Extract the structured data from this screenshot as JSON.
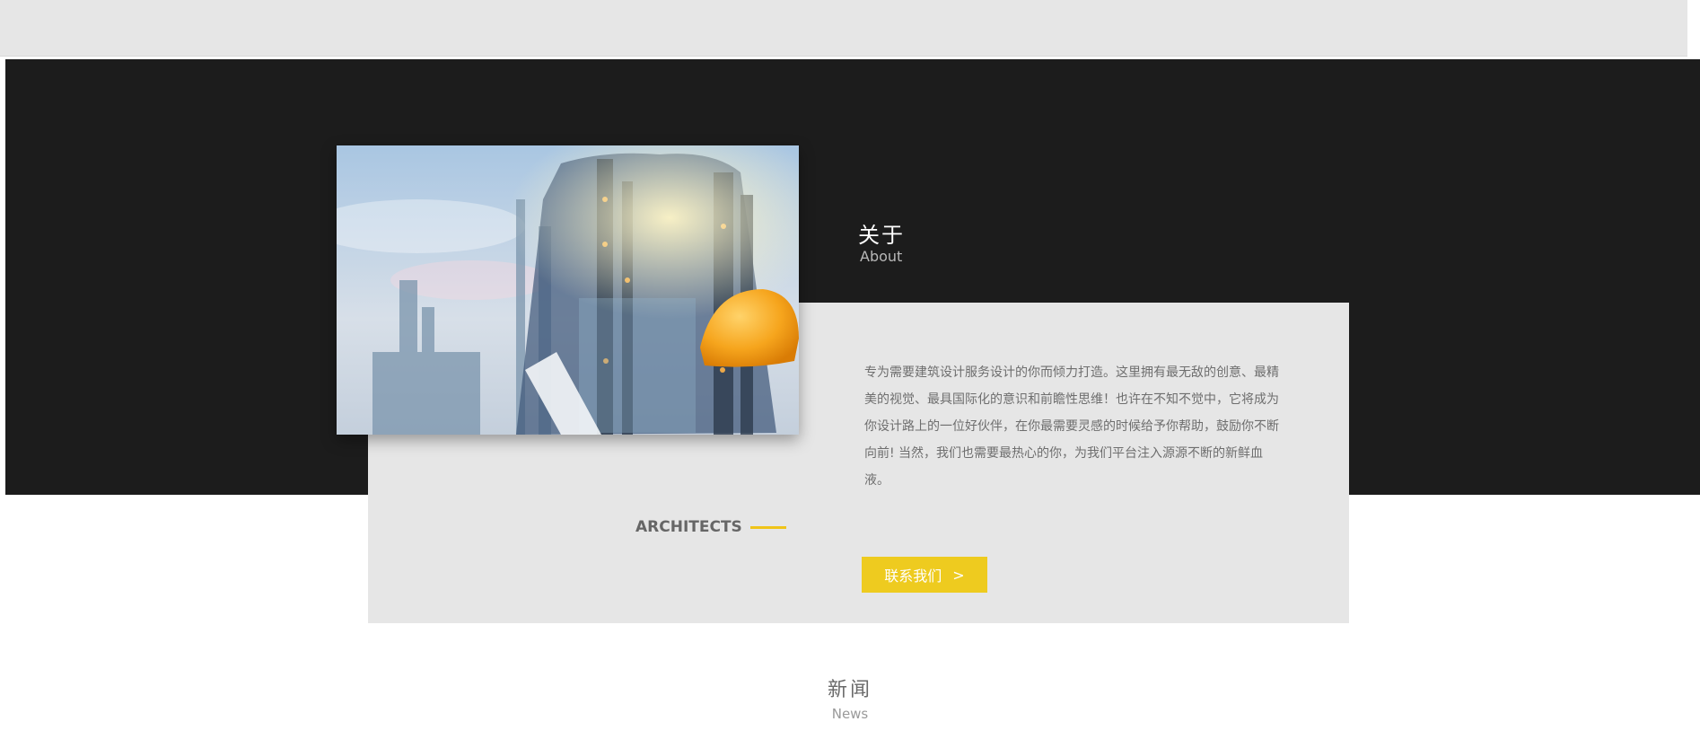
{
  "about": {
    "title": "关于",
    "subtitle": "About",
    "description": "专为需要建筑设计服务设计的你而倾力打造。这里拥有最无敌的创意、最精美的视觉、最具国际化的意识和前瞻性思维！也许在不知不觉中，它将成为你设计路上的一位好伙伴，在你最需要灵感的时候给予你帮助，鼓励你不断向前! 当然，我们也需要最热心的你，为我们平台注入源源不断的新鲜血液。",
    "tagline": "ARCHITECTS",
    "contact_label": "联系我们",
    "contact_arrow": ">"
  },
  "news": {
    "title": "新闻",
    "subtitle": "News"
  },
  "colors": {
    "accent": "#eecb1f",
    "dark_band": "#1c1c1c",
    "panel": "#e6e6e6"
  }
}
